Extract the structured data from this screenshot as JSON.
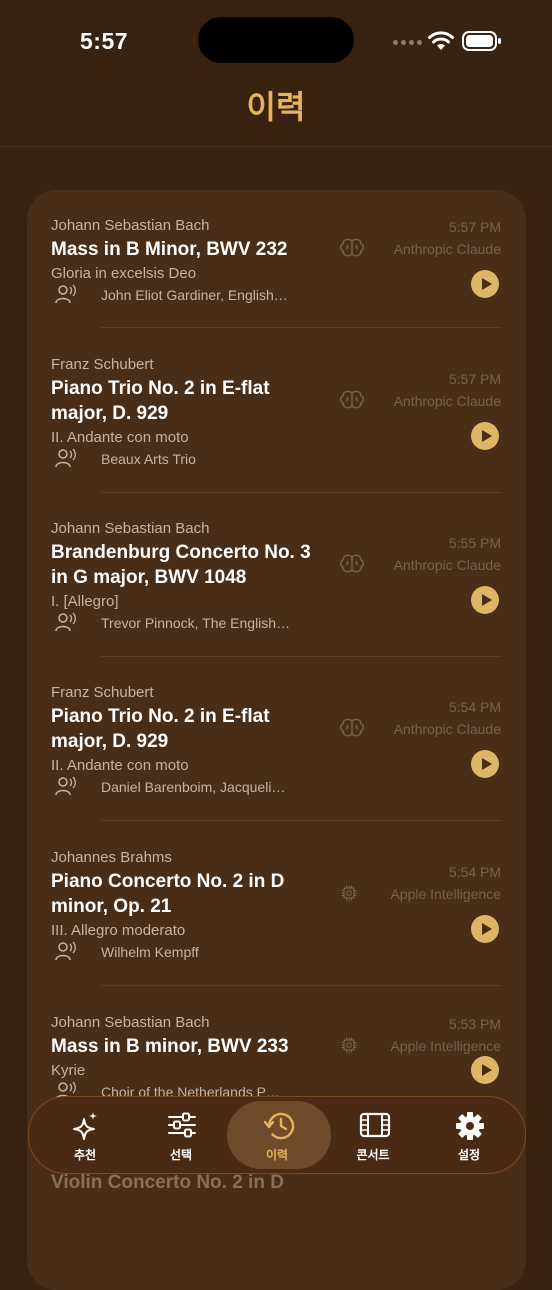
{
  "status": {
    "time": "5:57"
  },
  "header": {
    "title": "이력"
  },
  "entries": [
    {
      "composer": "Johann Sebastian Bach",
      "work": "Mass in B Minor, BWV 232",
      "movement": "Gloria in excelsis Deo",
      "performer": "John Eliot Gardiner, English…",
      "time": "5:57 PM",
      "model": "Anthropic Claude",
      "model_icon": "brain-icon"
    },
    {
      "composer": "Franz Schubert",
      "work": "Piano Trio No. 2 in E-flat major, D. 929",
      "movement": "II. Andante con moto",
      "performer": "Beaux Arts Trio",
      "time": "5:57 PM",
      "model": "Anthropic Claude",
      "model_icon": "brain-icon"
    },
    {
      "composer": "Johann Sebastian Bach",
      "work": "Brandenburg Concerto No. 3 in G major, BWV 1048",
      "movement": "I. [Allegro]",
      "performer": "Trevor Pinnock, The English…",
      "time": "5:55 PM",
      "model": "Anthropic Claude",
      "model_icon": "brain-icon"
    },
    {
      "composer": "Franz Schubert",
      "work": "Piano Trio No. 2 in E-flat major, D. 929",
      "movement": "II. Andante con moto",
      "performer": "Daniel Barenboim, Jacqueli…",
      "time": "5:54 PM",
      "model": "Anthropic Claude",
      "model_icon": "brain-icon"
    },
    {
      "composer": "Johannes Brahms",
      "work": "Piano Concerto No. 2 in D minor, Op. 21",
      "movement": "III. Allegro moderato",
      "performer": "Wilhelm Kempff",
      "time": "5:54 PM",
      "model": "Apple Intelligence",
      "model_icon": "chip-icon"
    },
    {
      "composer": "Johann Sebastian Bach",
      "work": "Mass in B minor, BWV 233",
      "movement": "Kyrie",
      "performer": "Choir of the Netherlands P…",
      "time": "5:53 PM",
      "model": "Apple Intelligence",
      "model_icon": "chip-icon"
    }
  ],
  "peek_entry": {
    "work": "Violin Concerto No. 2 in D"
  },
  "tabs": [
    {
      "label": "추천",
      "icon": "sparkles-icon",
      "active": false
    },
    {
      "label": "선택",
      "icon": "sliders-icon",
      "active": false
    },
    {
      "label": "이력",
      "icon": "history-icon",
      "active": true
    },
    {
      "label": "콘서트",
      "icon": "film-icon",
      "active": false
    },
    {
      "label": "설정",
      "icon": "gear-icon",
      "active": false
    }
  ],
  "colors": {
    "background": "#3a2211",
    "card": "#4a2d17",
    "accent": "#e2b45f",
    "play_button": "#dcb565"
  }
}
